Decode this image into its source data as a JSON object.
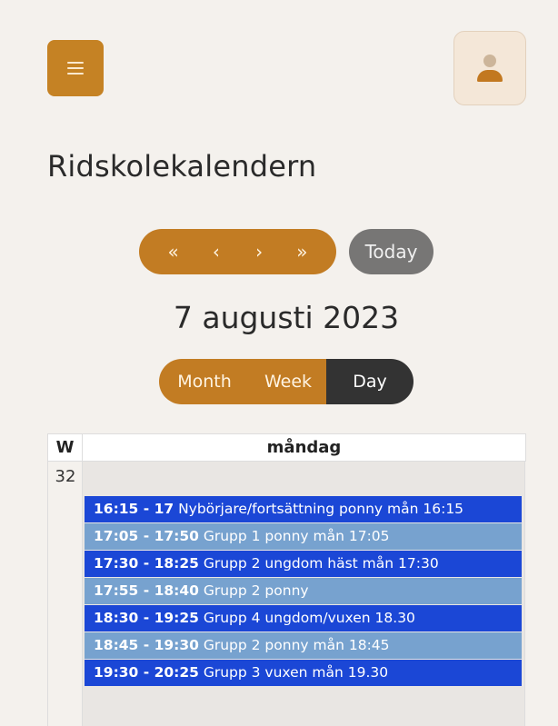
{
  "header": {
    "menu_icon": "hamburger-icon",
    "user_icon": "user-icon"
  },
  "title": "Ridskolekalendern",
  "nav": {
    "first": "«",
    "prev": "‹",
    "next": "›",
    "last": "»",
    "today": "Today"
  },
  "date": "7 augusti 2023",
  "views": {
    "month": "Month",
    "week": "Week",
    "day": "Day",
    "active": "Day"
  },
  "calendar": {
    "week_header": "W",
    "day_header": "måndag",
    "week_number": "32",
    "events": [
      {
        "time": "16:15 - 17",
        "title": "Nybörjare/fortsättning ponny mån 16:15",
        "color": "#1b47d6"
      },
      {
        "time": "17:05 - 17:50",
        "title": "Grupp 1 ponny mån 17:05",
        "color": "#77a2cf"
      },
      {
        "time": "17:30 - 18:25",
        "title": "Grupp 2 ungdom häst mån 17:30",
        "color": "#1b47d6"
      },
      {
        "time": "17:55 - 18:40",
        "title": "Grupp 2 ponny",
        "color": "#77a2cf"
      },
      {
        "time": "18:30 - 19:25",
        "title": "Grupp 4 ungdom/vuxen 18.30",
        "color": "#1b47d6"
      },
      {
        "time": "18:45 - 19:30",
        "title": "Grupp 2 ponny mån 18:45",
        "color": "#77a2cf"
      },
      {
        "time": "19:30 - 20:25",
        "title": "Grupp 3 vuxen mån 19.30",
        "color": "#1b47d6"
      }
    ]
  },
  "colors": {
    "accent": "#c27c23",
    "background": "#f4f1ed",
    "event_dark": "#1b47d6",
    "event_light": "#77a2cf"
  }
}
